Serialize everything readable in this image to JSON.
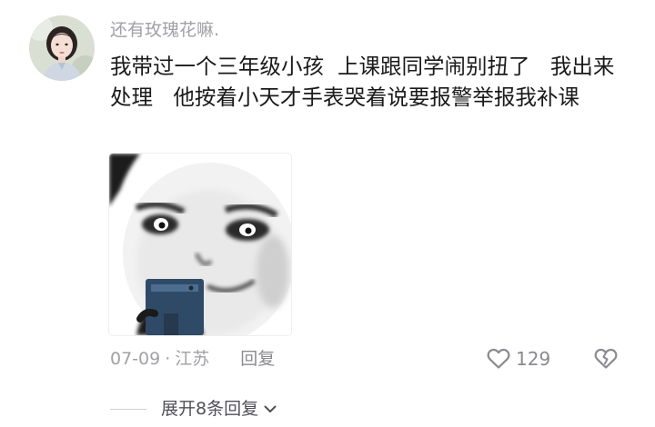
{
  "comment": {
    "username": "还有玫瑰花嘛.",
    "text": "我带过一个三年级小孩  上课跟同学闹别扭了   我出来处理   他按着小天才手表哭着说要报警举报我补课",
    "meme_description": "meme",
    "date": "07-09",
    "separator": "·",
    "location": "江苏",
    "reply_label": "回复",
    "like_count": "129",
    "expand_label": "展开8条回复"
  },
  "icons": {
    "like": "heart-outline-icon",
    "dislike": "broken-heart-icon",
    "expand": "chevron-down-icon"
  },
  "colors": {
    "text_primary": "#1a1a1a",
    "text_secondary": "#a1a1a6",
    "icon": "#8a8a8f"
  }
}
